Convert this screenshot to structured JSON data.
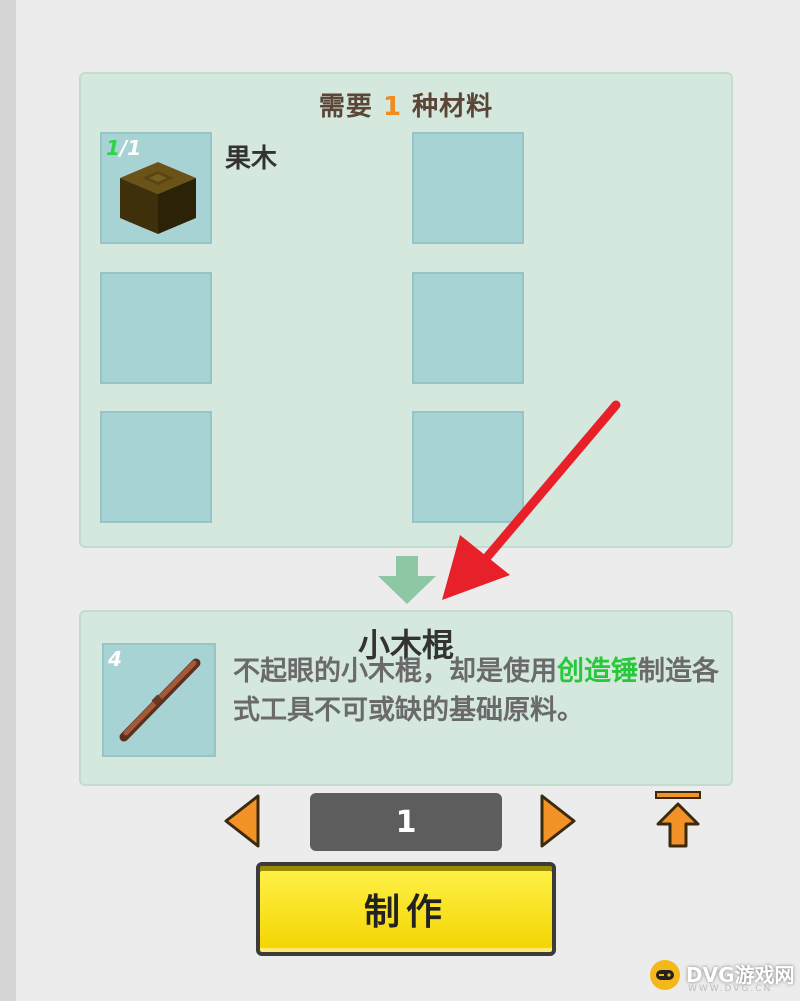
{
  "materials": {
    "title_prefix": "需要",
    "count": "1",
    "title_suffix": "种材料",
    "items": [
      {
        "count_have": "1",
        "count_sep": "/1",
        "name": "果木",
        "icon": "fruitwood-block-icon"
      }
    ]
  },
  "result": {
    "quantity_badge": "4",
    "title": "小木棍",
    "desc_part1": "不起眼的小木棍，却是使用",
    "desc_highlight": "创造锤",
    "desc_part2": "制造各式工具不可或缺的基础原料。",
    "icon": "wooden-stick-icon"
  },
  "controls": {
    "quantity": "1",
    "decrease_icon": "triangle-left-icon",
    "increase_icon": "triangle-right-icon",
    "max_icon": "max-up-arrow-icon",
    "make_label": "制作"
  },
  "watermark": {
    "text": "DVG游戏网",
    "sub": "WWW.DVG.CN"
  },
  "colors": {
    "panel": "#d5e8de",
    "slot": "#a8d3d4",
    "accent_orange": "#f08b1d",
    "highlight_green": "#27c93a",
    "make_button": "#f3d400",
    "annotation_red": "#e8202a"
  }
}
